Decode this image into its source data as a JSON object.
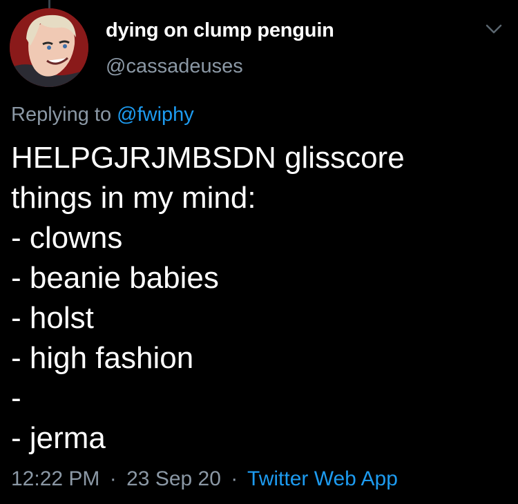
{
  "tweet": {
    "display_name": "dying on clump penguin",
    "handle": "@cassadeuses",
    "reply_prefix": "Replying to",
    "reply_to": "@fwiphy",
    "lines": [
      "HELPGJRJMBSDN glisscore",
      "things in my mind:",
      "- clowns",
      "- beanie babies",
      "- holst",
      "- high fashion",
      "-",
      "- jerma"
    ],
    "time": "12:22 PM",
    "date": "23 Sep 20",
    "separator": "·",
    "source": "Twitter Web App"
  },
  "icons": {
    "menu": "chevron-down-icon",
    "avatar": "profile-avatar"
  },
  "colors": {
    "background": "#000000",
    "text": "#ffffff",
    "secondary_text": "#8b98a5",
    "link": "#1d9bf0"
  }
}
